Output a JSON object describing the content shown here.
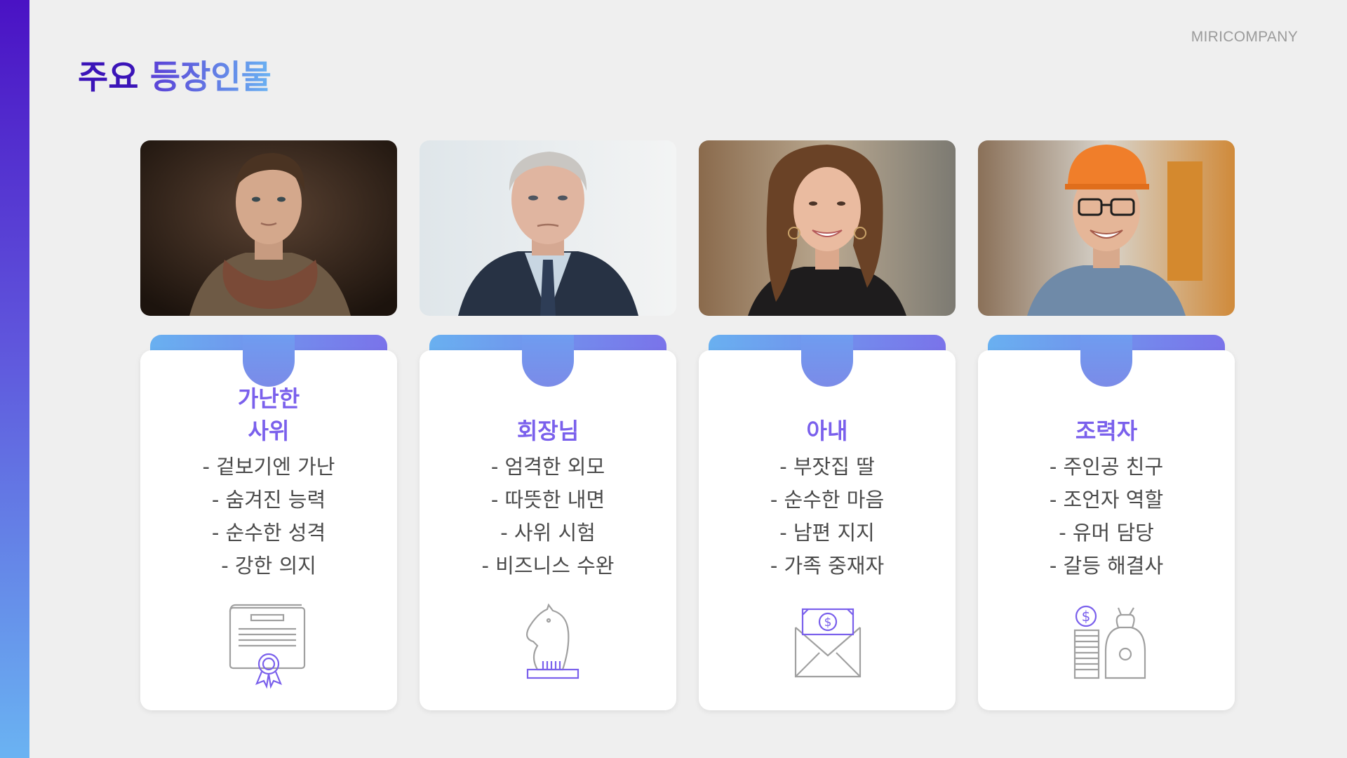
{
  "brand": "MIRICOMPANY",
  "title": {
    "part1": "주요",
    "part2": "등장인물"
  },
  "characters": [
    {
      "role": "가난한\n사위",
      "traits": [
        "- 겉보기엔 가난",
        "- 숨겨진 능력",
        "- 순수한 성격",
        "- 강한 의지"
      ],
      "icon": "certificate-icon",
      "photo": "young-man-portrait"
    },
    {
      "role": "회장님",
      "traits": [
        "- 엄격한 외모",
        "- 따뜻한 내면",
        "- 사위 시험",
        "- 비즈니스 수완"
      ],
      "icon": "chess-knight-icon",
      "photo": "elderly-chairman-portrait"
    },
    {
      "role": "아내",
      "traits": [
        "- 부잣집 딸",
        "- 순수한 마음",
        "- 남편 지지",
        "- 가족 중재자"
      ],
      "icon": "money-envelope-icon",
      "photo": "smiling-woman-portrait"
    },
    {
      "role": "조력자",
      "traits": [
        "- 주인공 친구",
        "- 조언자 역할",
        "- 유머 담당",
        "- 갈등 해결사"
      ],
      "icon": "coins-moneybag-icon",
      "photo": "smiling-friend-portrait"
    }
  ],
  "colors": {
    "accent_dark": "#3b14b8",
    "accent_purple": "#7a60ec",
    "accent_blue": "#6ab3f2",
    "background": "#efefef"
  }
}
